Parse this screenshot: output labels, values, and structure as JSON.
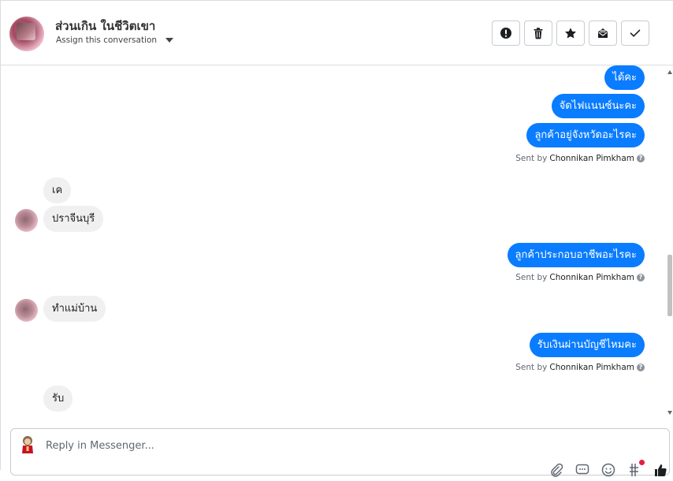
{
  "header": {
    "contact_name": "ส่วนเกิน ในชีวิตเขา",
    "assign_label": "Assign this conversation",
    "actions": [
      {
        "name": "mark-spam-button",
        "icon": "alert-circle-icon"
      },
      {
        "name": "delete-button",
        "icon": "trash-icon"
      },
      {
        "name": "star-button",
        "icon": "star-icon"
      },
      {
        "name": "mark-unread-button",
        "icon": "envelope-icon"
      },
      {
        "name": "mark-done-button",
        "icon": "check-icon"
      }
    ]
  },
  "thread": {
    "messages": [
      {
        "dir": "out",
        "text": "ได้คะ"
      },
      {
        "dir": "out",
        "text": "จัดไฟแนนซ์นะคะ"
      },
      {
        "dir": "out",
        "text": "ลูกค้าอยู่จังหวัดอะไรคะ"
      },
      {
        "dir": "in",
        "text": "เค"
      },
      {
        "dir": "in",
        "text": "ปราจีนบุรี"
      },
      {
        "dir": "out",
        "text": "ลูกค้าประกอบอาชีพอะไรคะ"
      },
      {
        "dir": "in",
        "text": "ทำแม่บ้าน"
      },
      {
        "dir": "out",
        "text": "รับเงินผ่านบัญชีไหมคะ"
      },
      {
        "dir": "in",
        "text": "รับ"
      }
    ],
    "sent_by_prefix": "Sent by",
    "sent_by_name": "Chonnikan Pimkham",
    "help_glyph": "?"
  },
  "composer": {
    "placeholder": "Reply in Messenger...",
    "tools": [
      "attach-icon",
      "saved-reply-icon",
      "emoji-icon",
      "tag-icon",
      "like-icon"
    ]
  },
  "colors": {
    "outgoing_bubble": "#0a7cff",
    "incoming_bubble": "#f0f0f0",
    "notification_dot": "#e41e3f"
  }
}
